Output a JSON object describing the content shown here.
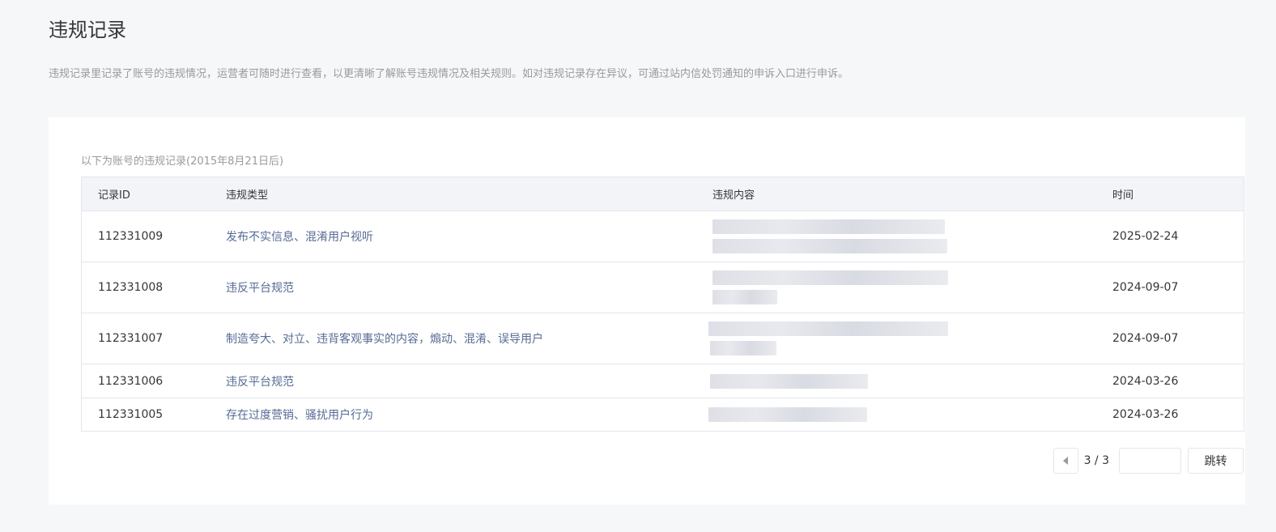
{
  "title": "违规记录",
  "description": "违规记录里记录了账号的违规情况，运营者可随时进行查看，以更清晰了解账号违规情况及相关规则。如对违规记录存在异议，可通过站内信处罚通知的申诉入口进行申诉。",
  "caption": "以下为账号的违规记录(2015年8月21日后)",
  "columns": [
    "记录ID",
    "违规类型",
    "违规内容",
    "时间"
  ],
  "rows": [
    {
      "id": "112331009",
      "type": "发布不实信息、混淆用户视听",
      "date": "2025-02-24"
    },
    {
      "id": "112331008",
      "type": "违反平台规范",
      "date": "2024-09-07"
    },
    {
      "id": "112331007",
      "type": "制造夸大、对立、违背客观事实的内容，煽动、混淆、误导用户",
      "date": "2024-09-07"
    },
    {
      "id": "112331006",
      "type": "违反平台规范",
      "date": "2024-03-26"
    },
    {
      "id": "112331005",
      "type": "存在过度营销、骚扰用户行为",
      "date": "2024-03-26"
    }
  ],
  "pager": {
    "page": "3 / 3",
    "jump_input": "",
    "jump_label": "跳转"
  }
}
